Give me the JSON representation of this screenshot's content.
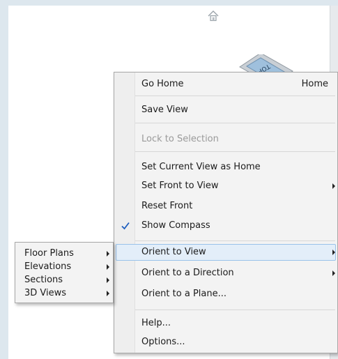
{
  "menu": {
    "items": [
      {
        "label": "Go Home",
        "shortcut": "Home"
      },
      {
        "label": "Save View"
      },
      {
        "label": "Lock to Selection",
        "disabled": true
      },
      {
        "label": "Set Current View as Home"
      },
      {
        "label": "Set Front to View"
      },
      {
        "label": "Reset Front"
      },
      {
        "label": "Show Compass",
        "checked": true
      },
      {
        "label": "Orient to View",
        "highlighted": true
      },
      {
        "label": "Orient to a Direction"
      },
      {
        "label": "Orient to a Plane..."
      },
      {
        "label": "Help..."
      },
      {
        "label": "Options..."
      }
    ]
  },
  "submenu": {
    "items": [
      {
        "label": "Floor Plans"
      },
      {
        "label": "Elevations"
      },
      {
        "label": "Sections"
      },
      {
        "label": "3D Views"
      }
    ]
  },
  "viewcube": {
    "face_label": "TOP"
  },
  "colors": {
    "highlight": "#e3eef9",
    "highlight_border": "#99c2ea",
    "check": "#1f5fbf"
  }
}
